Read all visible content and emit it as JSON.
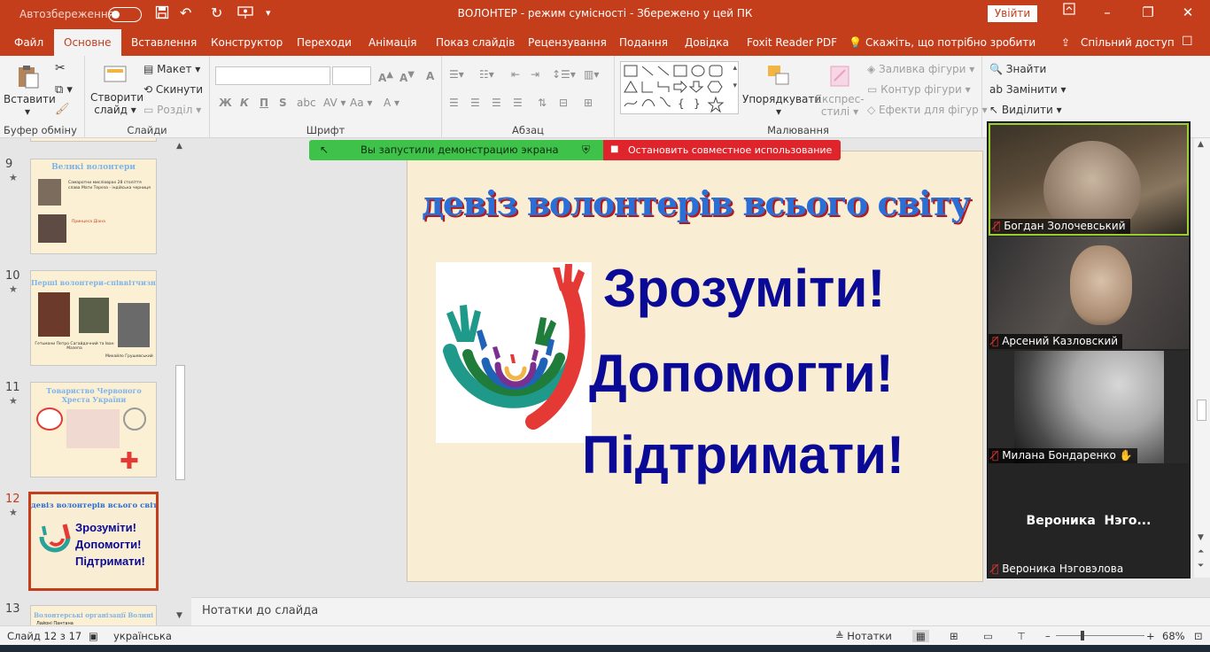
{
  "titlebar": {
    "autosave_label": "Автозбереження",
    "title": "ВОЛОНТЕР  -  режим сумісності  -  Збережено у цей ПК",
    "signin_label": "Увійти"
  },
  "ribbon_tabs": [
    {
      "label": "Файл"
    },
    {
      "label": "Основне"
    },
    {
      "label": "Вставлення"
    },
    {
      "label": "Конструктор"
    },
    {
      "label": "Переходи"
    },
    {
      "label": "Анімація"
    },
    {
      "label": "Показ слайдів"
    },
    {
      "label": "Рецензування"
    },
    {
      "label": "Подання"
    },
    {
      "label": "Довідка"
    },
    {
      "label": "Foxit Reader PDF"
    },
    {
      "label": "Скажіть, що потрібно зробити"
    }
  ],
  "share_label": "Спільний доступ",
  "ribbon": {
    "clipboard": {
      "paste": "Вставити",
      "group": "Буфер обміну"
    },
    "slides": {
      "new_slide_1": "Створити",
      "new_slide_2": "слайд",
      "layout": "Макет",
      "reset": "Скинути",
      "section": "Розділ",
      "group": "Слайди"
    },
    "font": {
      "group": "Шрифт"
    },
    "paragraph": {
      "group": "Абзац"
    },
    "drawing": {
      "arrange": "Упорядкувати",
      "quick_styles_1": "Експрес-",
      "quick_styles_2": "стилі",
      "fill": "Заливка фігури",
      "outline": "Контур фігури",
      "effects": "Ефекти для фігур",
      "group": "Малювання"
    },
    "editing": {
      "find": "Знайти",
      "replace": "Замінити",
      "select": "Виділити"
    }
  },
  "share_bar": {
    "green_text": "Вы запустили демонстрацию экрана",
    "red_text": "Остановить совместное использование"
  },
  "thumbnails": [
    {
      "num": "9",
      "title": "Великі волонтери",
      "body": "Самаротни мисліоврах 28 століття слава Мати Тереза - індійська черниця",
      "sub": "Принцеса Діана"
    },
    {
      "num": "10",
      "title": "Перші волонтери-співвітчизники",
      "body": "Гетьмани Петро Сагайдачний та Іван Мазепа",
      "sub": "Михайло Грушевський"
    },
    {
      "num": "11",
      "title": "Товариство Червоного Хреста України",
      "body": "",
      "sub": ""
    },
    {
      "num": "12",
      "title": "девіз волонтерів всього світу",
      "l1": "Зрозуміти!",
      "l2": "Допомогти!",
      "l3": "Підтримати!"
    },
    {
      "num": "13",
      "title": "Волонтерські організації Волині",
      "body": "Лайоні Пантана",
      "sub": ""
    }
  ],
  "slide": {
    "title": "девіз волонтерів всього світу",
    "line1": "Зрозуміти!",
    "line2": "Допомогти!",
    "line3": "Підтримати!"
  },
  "participants": [
    {
      "name": "Богдан Золочевський"
    },
    {
      "name": "Арсений Казловский"
    },
    {
      "name": "Милана Бондаренко"
    },
    {
      "name": "Вероника  Нэго...",
      "label": "Вероника Нэговэлова"
    }
  ],
  "notes_placeholder": "Нотатки до слайда",
  "statusbar": {
    "slide_info": "Слайд 12 з 17",
    "language": "українська",
    "notes_label": "Нотатки",
    "zoom": "68%"
  }
}
